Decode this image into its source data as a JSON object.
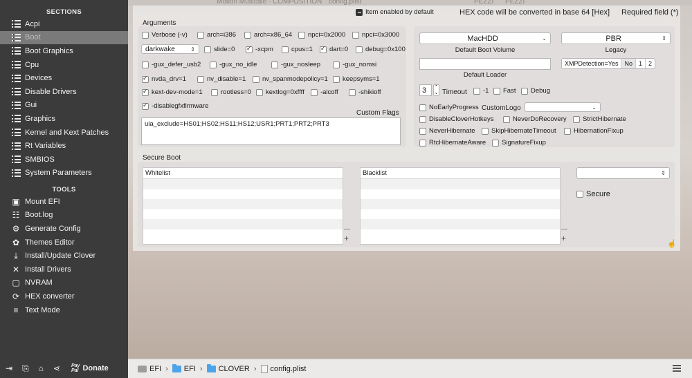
{
  "titlebar": {
    "ghost_left": "Motion Musicale · COMPOSITION",
    "ghost_mid": "config.plist",
    "ghost_r1": "PEZZI",
    "ghost_r2": "PEZZI"
  },
  "sidebar": {
    "sections_heading": "SECTIONS",
    "sections": [
      {
        "label": "Acpi",
        "active": false
      },
      {
        "label": "Boot",
        "active": true
      },
      {
        "label": "Boot Graphics",
        "active": false
      },
      {
        "label": "Cpu",
        "active": false
      },
      {
        "label": "Devices",
        "active": false
      },
      {
        "label": "Disable Drivers",
        "active": false
      },
      {
        "label": "Gui",
        "active": false
      },
      {
        "label": "Graphics",
        "active": false
      },
      {
        "label": "Kernel and Kext Patches",
        "active": false
      },
      {
        "label": "Rt Variables",
        "active": false
      },
      {
        "label": "SMBIOS",
        "active": false
      },
      {
        "label": "System Parameters",
        "active": false
      }
    ],
    "tools_heading": "TOOLS",
    "tools": [
      {
        "label": "Mount EFI",
        "icon": "disk-icon",
        "glyph": "▣"
      },
      {
        "label": "Boot.log",
        "icon": "log-icon",
        "glyph": "☷"
      },
      {
        "label": "Generate Config",
        "icon": "gears-icon",
        "glyph": "⚙"
      },
      {
        "label": "Themes Editor",
        "icon": "palette-icon",
        "glyph": "✿"
      },
      {
        "label": "Install/Update Clover",
        "icon": "download-icon",
        "glyph": "⤓"
      },
      {
        "label": "Install Drivers",
        "icon": "tools-icon",
        "glyph": "✕"
      },
      {
        "label": "NVRAM",
        "icon": "chip-icon",
        "glyph": "▢"
      },
      {
        "label": "HEX converter",
        "icon": "refresh-icon",
        "glyph": "⟳"
      },
      {
        "label": "Text Mode",
        "icon": "text-icon",
        "glyph": "≡"
      }
    ],
    "footer": {
      "pay": "Pay",
      "pal": "Pal",
      "donate": "Donate"
    }
  },
  "header": {
    "item_enabled": "Item enabled by default",
    "hex_note": "HEX code will be converted in base 64 [Hex]",
    "required": "Required field (*)"
  },
  "arguments": {
    "label": "Arguments",
    "row1": [
      {
        "label": "Verbose (-v)",
        "checked": false
      },
      {
        "label": "arch=i386",
        "checked": false
      },
      {
        "label": "arch=x86_64",
        "checked": false
      },
      {
        "label": "npci=0x2000",
        "checked": false
      },
      {
        "label": "npci=0x3000",
        "checked": false
      }
    ],
    "darkwake": "darkwake",
    "row2": [
      {
        "label": "slide=0",
        "checked": false
      },
      {
        "label": "-xcpm",
        "checked": true
      },
      {
        "label": "cpus=1",
        "checked": false
      },
      {
        "label": "dart=0",
        "checked": true
      },
      {
        "label": "debug=0x100",
        "checked": false
      }
    ],
    "row3": [
      {
        "label": "-gux_defer_usb2",
        "checked": false
      },
      {
        "label": "-gux_no_idle",
        "checked": false
      },
      {
        "label": "-gux_nosleep",
        "checked": false
      },
      {
        "label": "-gux_nomsi",
        "checked": false
      }
    ],
    "row4": [
      {
        "label": "nvda_drv=1",
        "checked": true
      },
      {
        "label": "nv_disable=1",
        "checked": false
      },
      {
        "label": "nv_spanmodepolicy=1",
        "checked": false
      },
      {
        "label": "keepsyms=1",
        "checked": false
      }
    ],
    "row5": [
      {
        "label": "kext-dev-mode=1",
        "checked": true
      },
      {
        "label": "rootless=0",
        "checked": false
      },
      {
        "label": "kextlog=0xffff",
        "checked": false
      },
      {
        "label": "-alcoff",
        "checked": false
      },
      {
        "label": "-shikioff",
        "checked": false
      }
    ],
    "row6": [
      {
        "label": "-disablegfxfirmware",
        "checked": true
      }
    ],
    "custom_flags_label": "Custom Flags",
    "custom_flags_value": "uia_exclude=HS01;HS02;HS11;HS12;USR1;PRT1;PRT2;PRT3"
  },
  "boot_right": {
    "default_volume": "MacHDD",
    "default_volume_caption": "Default Boot Volume",
    "legacy": "PBR",
    "legacy_caption": "Legacy",
    "default_loader_caption": "Default Loader",
    "xmp": [
      "XMPDetection=Yes",
      "No",
      "1",
      "2"
    ],
    "timeout_value": "3",
    "timeout_label": "Timeout",
    "timeout_opts": [
      {
        "label": "-1",
        "checked": false
      },
      {
        "label": "Fast",
        "checked": false
      },
      {
        "label": "Debug",
        "checked": false
      }
    ],
    "no_early": "NoEarlyProgress",
    "custom_logo": "CustomLogo",
    "flags_row1": [
      {
        "label": "DisableCloverHotkeys",
        "checked": false
      },
      {
        "label": "NeverDoRecovery",
        "checked": false
      },
      {
        "label": "StrictHibernate",
        "checked": false
      }
    ],
    "flags_row2": [
      {
        "label": "NeverHibernate",
        "checked": false
      },
      {
        "label": "SkipHibernateTimeout",
        "checked": false
      },
      {
        "label": "HibernationFixup",
        "checked": false
      }
    ],
    "flags_row3": [
      {
        "label": "RtcHibernateAware",
        "checked": false
      },
      {
        "label": "SignatureFixup",
        "checked": false
      }
    ]
  },
  "secure_boot": {
    "label": "Secure Boot",
    "whitelist": "Whitelist",
    "blacklist": "Blacklist",
    "secure": "Secure",
    "plus": "+",
    "minus": "—"
  },
  "breadcrumb": [
    "EFI",
    "EFI",
    "CLOVER",
    "config.plist"
  ]
}
